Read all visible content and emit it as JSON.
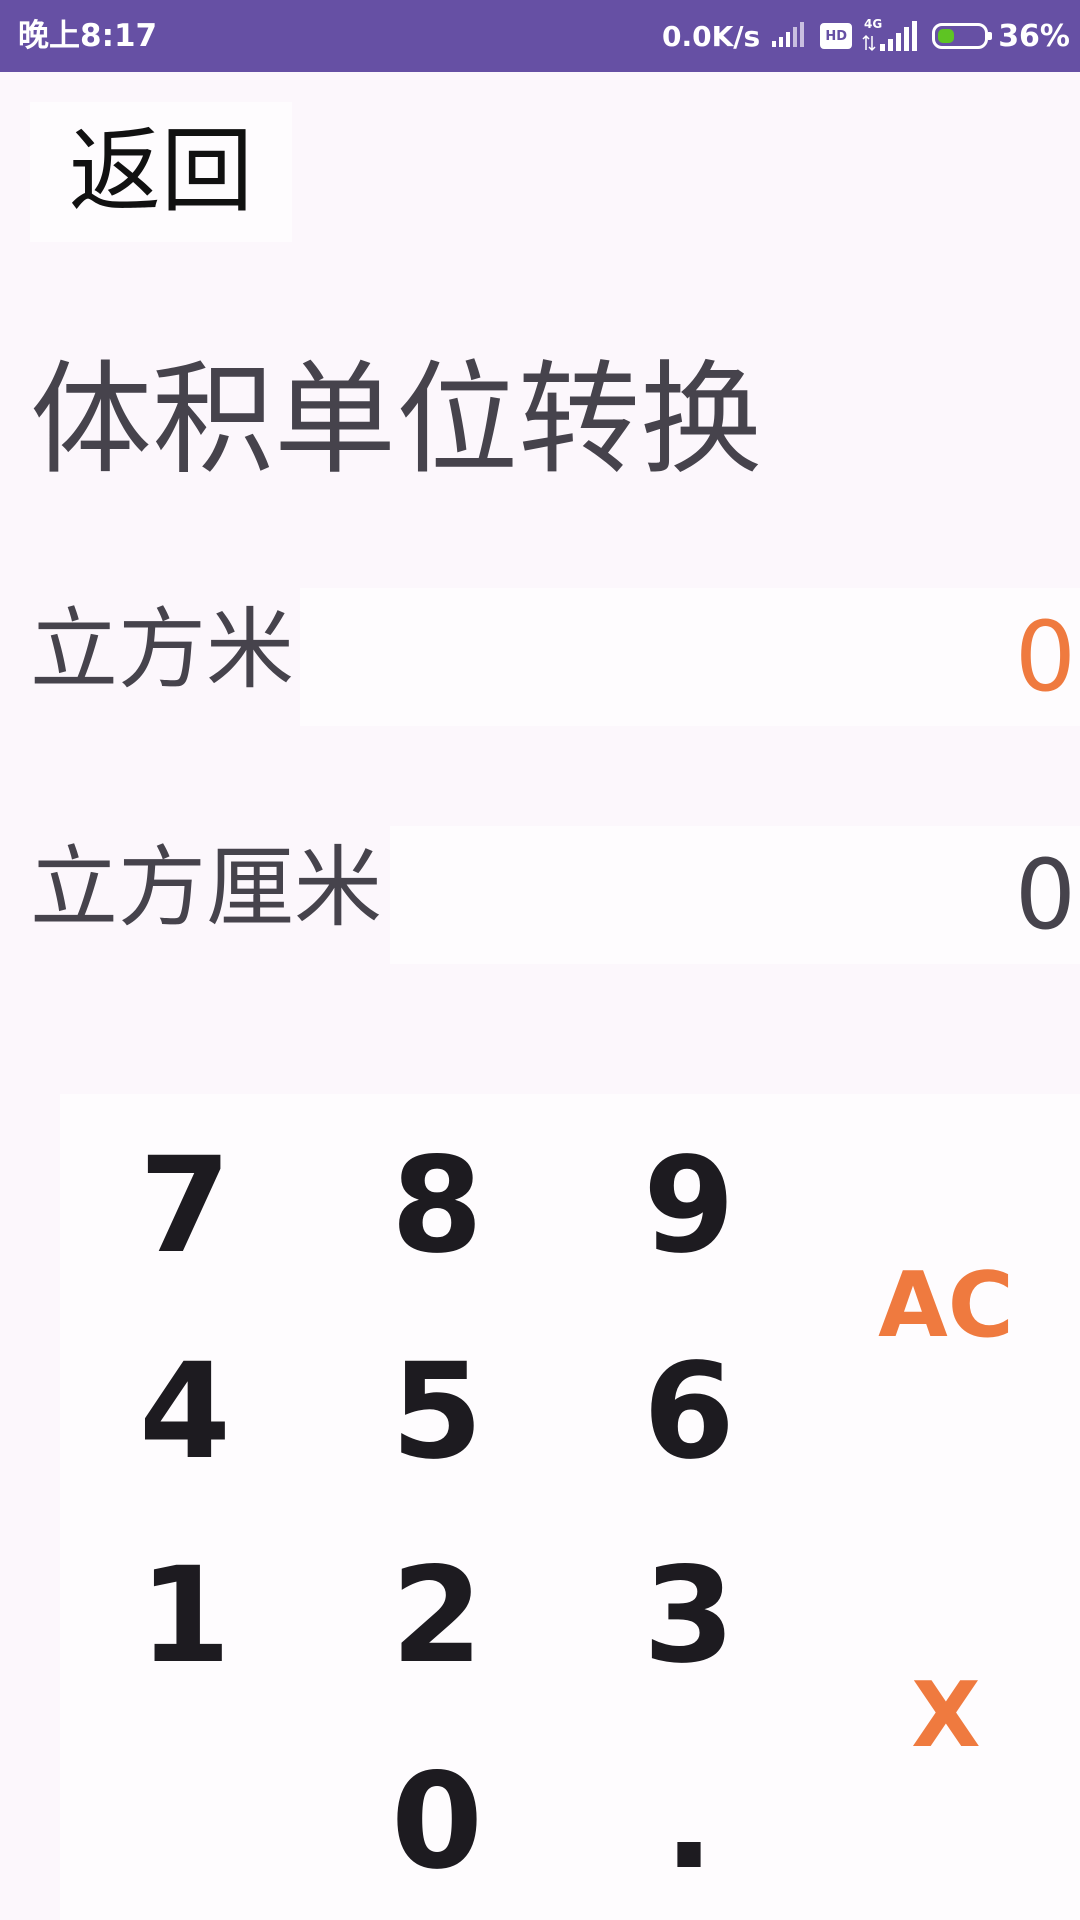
{
  "status_bar": {
    "time": "晚上8:17",
    "net_speed": "0.0K/s",
    "hd_badge": "HD",
    "network_type": "4G",
    "battery_percent": "36%",
    "battery_level": 0.36,
    "background_color": "#6650a4",
    "battery_color": "#5ec423"
  },
  "header": {
    "back_label": "返回",
    "title": "体积单位转换"
  },
  "units": [
    {
      "label": "立方米",
      "value": "0",
      "active": true
    },
    {
      "label": "立方厘米",
      "value": "0",
      "active": false
    }
  ],
  "keypad": {
    "keys": [
      "7",
      "8",
      "9",
      "4",
      "5",
      "6",
      "1",
      "2",
      "3",
      "0",
      "."
    ],
    "clear_label": "AC",
    "delete_label": "X"
  },
  "colors": {
    "accent": "#ef7a3f",
    "text_primary": "#1d1b20",
    "text_secondary": "#46434c",
    "background": "#fcf7fc"
  }
}
